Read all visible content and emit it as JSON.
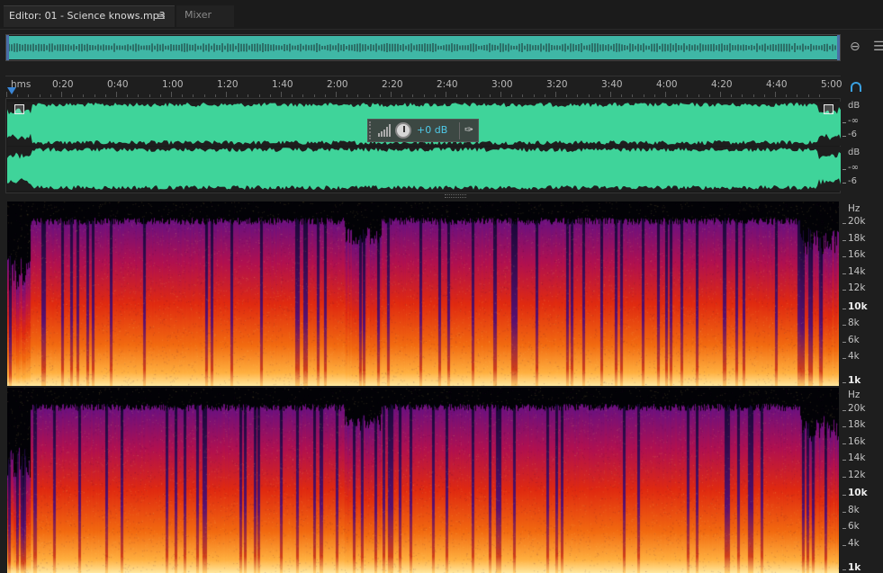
{
  "tabs": {
    "editor_label": "Editor: 01 - Science knows.mp3",
    "menu_icon": "≡",
    "mixer_label": "Mixer"
  },
  "ruler": {
    "units_label": "hms",
    "marks": [
      "0:20",
      "0:40",
      "1:00",
      "1:20",
      "1:40",
      "2:00",
      "2:20",
      "2:40",
      "3:00",
      "3:20",
      "3:40",
      "4:00",
      "4:20",
      "4:40",
      "5:00"
    ]
  },
  "hud": {
    "volume_value": "+0 dB"
  },
  "waveform": {
    "color": "#3fd49a",
    "db_scale_channel_1": [
      "dB",
      "-∞",
      "-6"
    ],
    "db_scale_channel_2": [
      "dB",
      "-∞",
      "-6"
    ]
  },
  "spectral": {
    "hz_scale_channel_1": [
      "Hz",
      "20k",
      "18k",
      "16k",
      "14k",
      "12k",
      "10k",
      "8k",
      "6k",
      "4k",
      "1k"
    ],
    "hz_scale_channel_2": [
      "Hz",
      "20k",
      "18k",
      "16k",
      "14k",
      "12k",
      "10k",
      "8k",
      "6k",
      "4k",
      "1k"
    ]
  },
  "icons": {
    "zoom": "zoom-out-full-icon",
    "list": "list-icon",
    "headphones": "headphones-icon",
    "pin": "pin-icon",
    "knob": "volume-knob-icon"
  }
}
